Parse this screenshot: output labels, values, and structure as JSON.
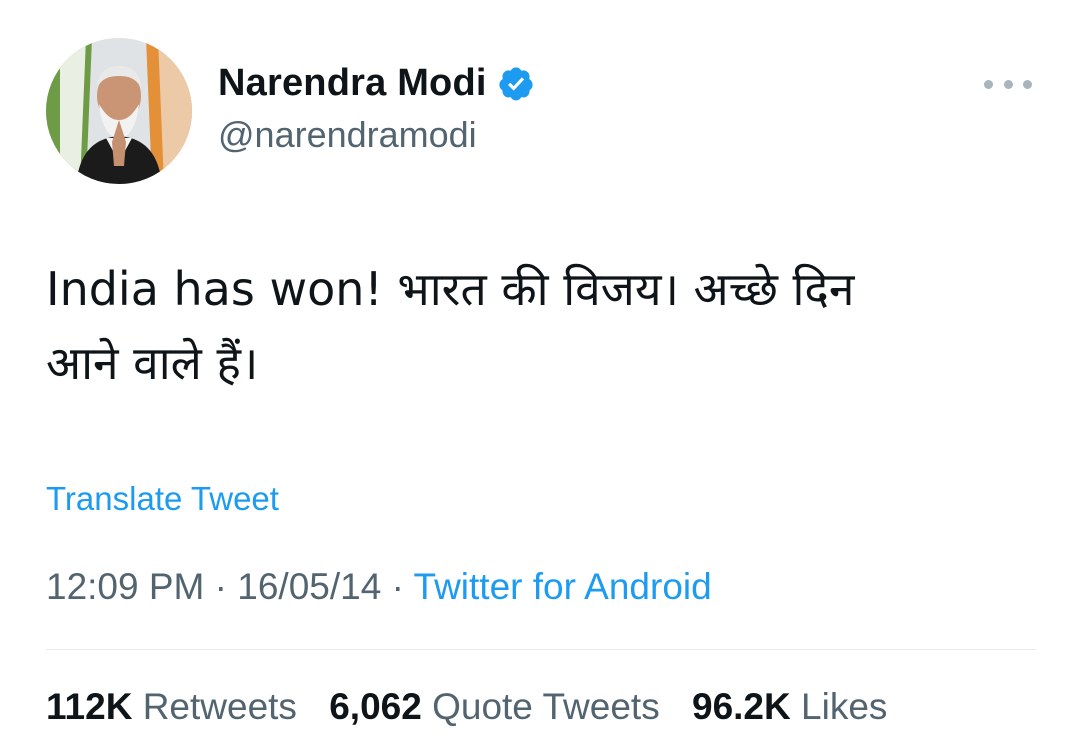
{
  "author": {
    "display_name": "Narendra Modi",
    "handle": "@narendramodi",
    "verified": true
  },
  "icons": {
    "verified": "verified-badge-icon",
    "more": "more-options-icon"
  },
  "tweet": {
    "text_line1": "India has won! भारत की विजय। अच्छे दिन",
    "text_line2": "आने वाले हैं।",
    "translate_label": "Translate Tweet"
  },
  "meta": {
    "time": "12:09 PM",
    "separator1": " · ",
    "date": "16/05/14",
    "separator2": " · ",
    "source": "Twitter for Android"
  },
  "stats": {
    "retweets_count": "112K",
    "retweets_label": "Retweets",
    "quotes_count": "6,062",
    "quotes_label": "Quote Tweets",
    "likes_count": "96.2K",
    "likes_label": "Likes"
  },
  "colors": {
    "link_blue": "#1d9bf0",
    "text_primary": "#0f1419",
    "text_secondary": "#536471",
    "divider": "#e7e9eb"
  }
}
